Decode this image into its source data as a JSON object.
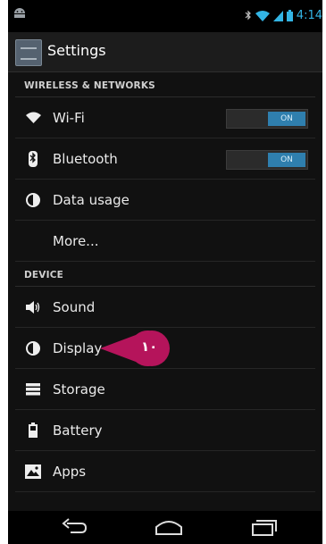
{
  "status_bar": {
    "time": "4:14",
    "icons": [
      "android-icon",
      "bluetooth-icon",
      "wifi-icon",
      "signal-icon",
      "battery-icon"
    ],
    "accent_color": "#33b5e5"
  },
  "action_bar": {
    "title": "Settings",
    "icon": "settings-app-icon"
  },
  "sections": {
    "wireless": "WIRELESS & NETWORKS",
    "device": "DEVICE"
  },
  "items": {
    "wifi": {
      "label": "Wi-Fi",
      "toggle": "ON",
      "icon": "wifi-icon"
    },
    "bluetooth": {
      "label": "Bluetooth",
      "toggle": "ON",
      "icon": "bluetooth-icon"
    },
    "data_usage": {
      "label": "Data usage",
      "icon": "data-usage-icon"
    },
    "more": {
      "label": "More..."
    },
    "sound": {
      "label": "Sound",
      "icon": "sound-icon"
    },
    "display": {
      "label": "Display",
      "icon": "display-icon"
    },
    "storage": {
      "label": "Storage",
      "icon": "storage-icon"
    },
    "battery": {
      "label": "Battery",
      "icon": "battery-icon"
    },
    "apps": {
      "label": "Apps",
      "icon": "apps-icon"
    }
  },
  "callout": {
    "text": "١٠",
    "color": "#b5145b"
  },
  "nav": {
    "buttons": [
      "back-icon",
      "home-icon",
      "recent-apps-icon"
    ]
  }
}
